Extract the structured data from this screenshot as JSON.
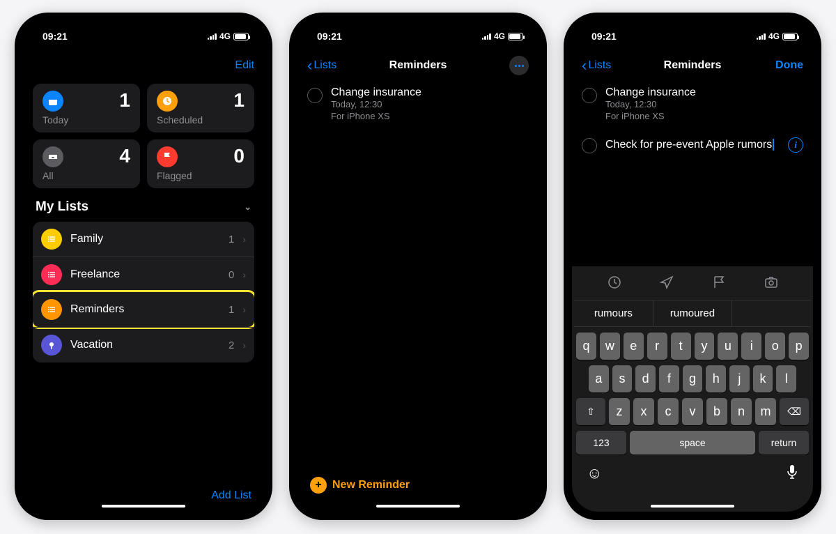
{
  "status": {
    "time": "09:21",
    "carrier": "4G"
  },
  "accent": "#0a84ff",
  "colors": {
    "today": "#0a84ff",
    "scheduled": "#ff9f0a",
    "all": "#5b5b60",
    "flagged": "#ff3b30",
    "family": "#ffcc00",
    "freelance": "#ff2d55",
    "reminders": "#ff9500",
    "vacation": "#5856d6",
    "highlight": "#f9e430"
  },
  "phone1": {
    "editLabel": "Edit",
    "cards": {
      "today": {
        "label": "Today",
        "count": 1
      },
      "scheduled": {
        "label": "Scheduled",
        "count": 1
      },
      "all": {
        "label": "All",
        "count": 4
      },
      "flagged": {
        "label": "Flagged",
        "count": 0
      }
    },
    "myListsHeader": "My Lists",
    "lists": [
      {
        "name": "Family",
        "count": 1,
        "highlighted": false
      },
      {
        "name": "Freelance",
        "count": 0,
        "highlighted": false
      },
      {
        "name": "Reminders",
        "count": 1,
        "highlighted": true
      },
      {
        "name": "Vacation",
        "count": 2,
        "highlighted": false
      }
    ],
    "addListLabel": "Add List"
  },
  "phone2": {
    "backLabel": "Lists",
    "title": "Reminders",
    "reminders": [
      {
        "title": "Change insurance",
        "subtitle1": "Today, 12:30",
        "subtitle2": "For iPhone XS"
      }
    ],
    "newReminderLabel": "New Reminder"
  },
  "phone3": {
    "backLabel": "Lists",
    "title": "Reminders",
    "doneLabel": "Done",
    "reminders": [
      {
        "title": "Change insurance",
        "subtitle1": "Today, 12:30",
        "subtitle2": "For iPhone XS",
        "editing": false
      },
      {
        "title": "Check for pre-event Apple rumors",
        "editing": true
      }
    ],
    "suggestions": [
      "rumours",
      "rumoured",
      ""
    ],
    "keyboard": {
      "row1": [
        "q",
        "w",
        "e",
        "r",
        "t",
        "y",
        "u",
        "i",
        "o",
        "p"
      ],
      "row2": [
        "a",
        "s",
        "d",
        "f",
        "g",
        "h",
        "j",
        "k",
        "l"
      ],
      "row3": [
        "z",
        "x",
        "c",
        "v",
        "b",
        "n",
        "m"
      ],
      "shift": "⇧",
      "delete": "⌫",
      "numKey": "123",
      "space": "space",
      "return": "return"
    }
  }
}
